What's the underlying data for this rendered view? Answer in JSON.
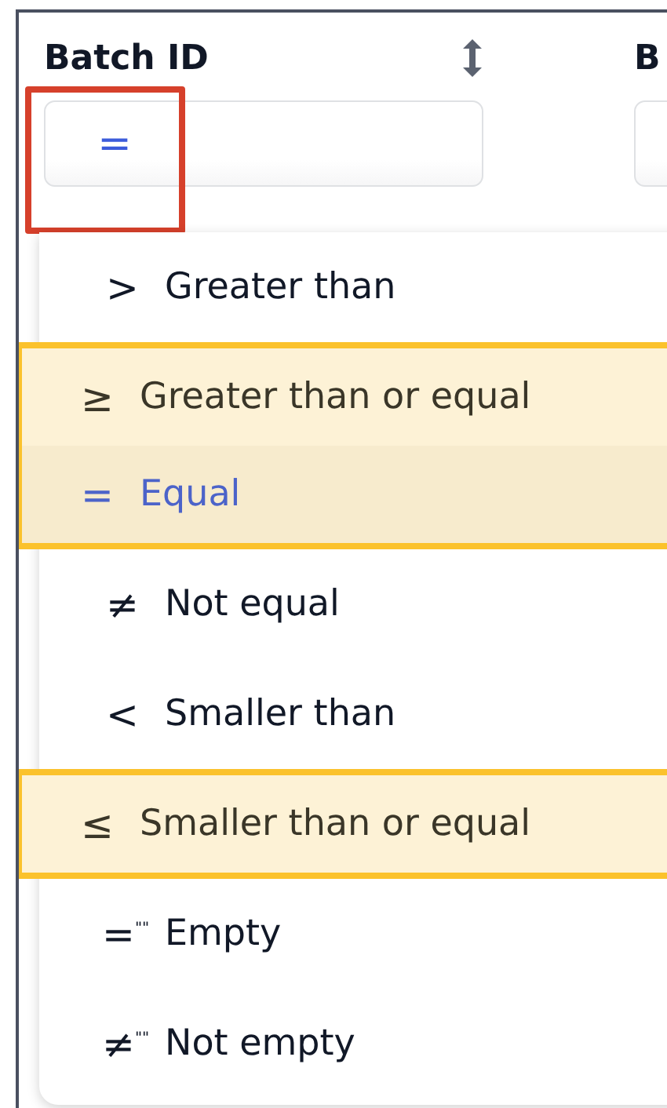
{
  "columns": [
    {
      "title": "Batch ID",
      "sortable": true,
      "filter": {
        "operator": "=",
        "outlined": true
      }
    },
    {
      "title": "B"
    }
  ],
  "operator_menu": {
    "options": [
      {
        "symbol": ">",
        "label": "Greater than",
        "selected": false,
        "highlighted": false
      },
      {
        "symbol": "≥",
        "label": "Greater than or equal",
        "selected": false,
        "highlighted": true
      },
      {
        "symbol": "=",
        "label": "Equal",
        "selected": true,
        "highlighted": true
      },
      {
        "symbol": "≠",
        "label": "Not equal",
        "selected": false,
        "highlighted": false
      },
      {
        "symbol": "<",
        "label": "Smaller than",
        "selected": false,
        "highlighted": false
      },
      {
        "symbol": "≤",
        "label": "Smaller than or equal",
        "selected": false,
        "highlighted": true
      },
      {
        "symbol": "=$^{\"\"}$",
        "label": "Empty",
        "selected": false,
        "highlighted": false
      },
      {
        "symbol": "≠$^{\"\"}$",
        "label": "Not empty",
        "selected": false,
        "highlighted": false
      }
    ]
  }
}
